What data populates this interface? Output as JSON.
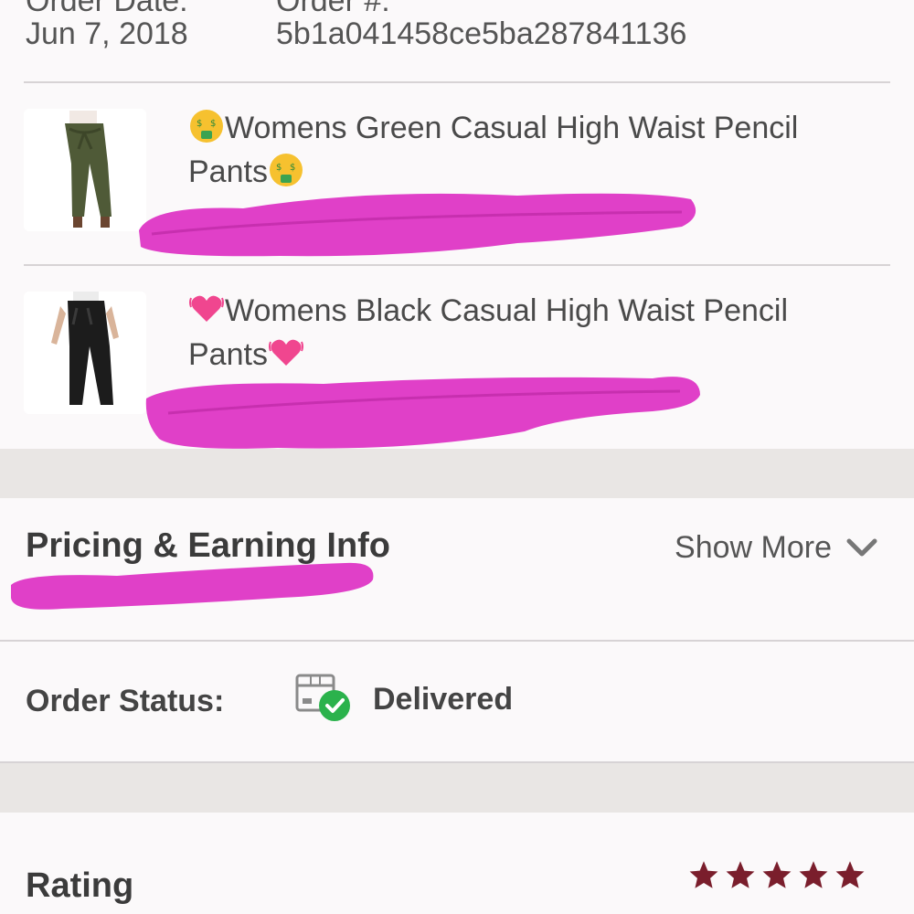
{
  "order": {
    "date_label": "Order Date:",
    "date_value": "Jun 7, 2018",
    "id_label": "Order #:",
    "id_value": "5b1a041458ce5ba287841136"
  },
  "products": [
    {
      "title": "Womens Green Casual High Waist Pencil Pants",
      "emoji": "money-mouth-face-icon",
      "pants_color": "#4f5a37"
    },
    {
      "title": "Womens Black Casual High Waist Pencil Pants",
      "emoji": "beating-heart-icon",
      "pants_color": "#1c1c1c"
    }
  ],
  "pricing": {
    "title": "Pricing & Earning Info",
    "show_more": "Show More"
  },
  "status": {
    "label": "Order Status:",
    "value": "Delivered",
    "check_color": "#2bb24c"
  },
  "rating": {
    "label": "Rating",
    "stars": 5,
    "star_color": "#7a1e2c"
  },
  "redaction_color": "#e040c8"
}
